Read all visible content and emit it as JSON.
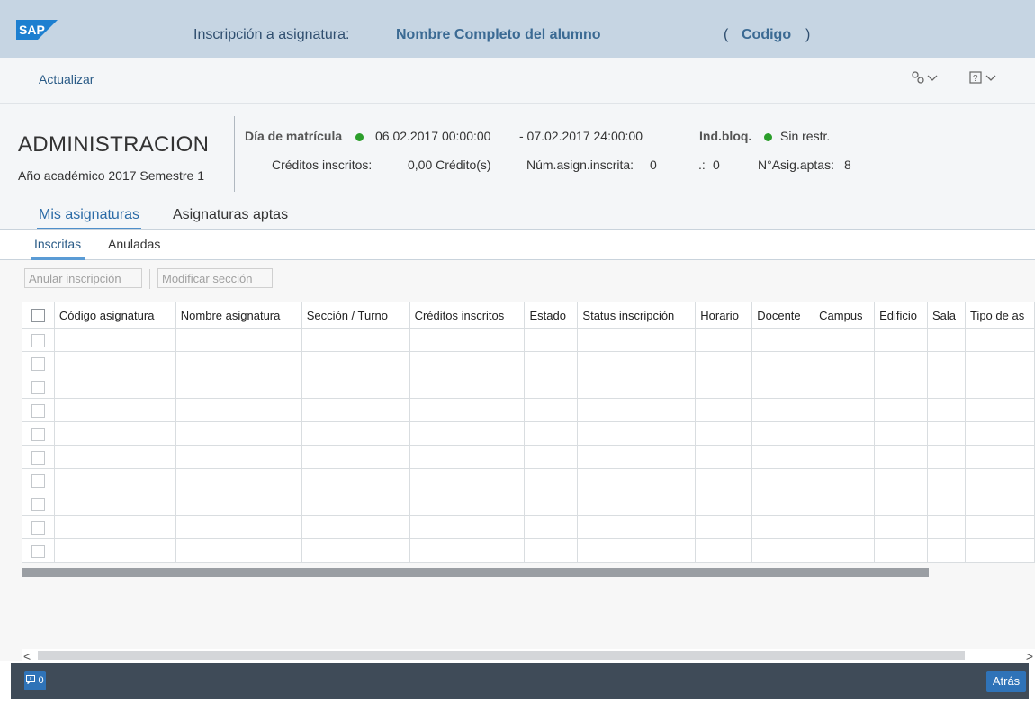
{
  "shell": {
    "logo_text": "SAP",
    "title_label": "Inscripción a asignatura:",
    "student_name": "Nombre Completo del alumno",
    "paren_open": "(",
    "code": "Codigo",
    "paren_close": ")"
  },
  "toolbar": {
    "refresh_label": "Actualizar",
    "settings_icon": "gear-icon",
    "help_icon": "help-icon"
  },
  "header": {
    "title": "ADMINISTRACION",
    "subtitle": "Año académico 2017 Semestre 1",
    "enrollment_day_label": "Día de matrícula",
    "enrollment_start": "06.02.2017 00:00:00",
    "enrollment_end": "- 07.02.2017 24:00:00",
    "block_label": "Ind.bloq.",
    "block_value": "Sin restr.",
    "credits_label": "Créditos inscritos:",
    "credits_value": "0,00 Crédito(s)",
    "enrolled_count_label": "Núm.asign.inscrita:",
    "enrolled_count_value": "0",
    "misc_label": ".:",
    "misc_value": "0",
    "eligible_label": "N°Asig.aptas:",
    "eligible_value": "8",
    "status_color": "#2b9e2b"
  },
  "tabs": {
    "primary": [
      "Mis asignaturas",
      "Asignaturas aptas"
    ],
    "secondary": [
      "Inscritas",
      "Anuladas"
    ]
  },
  "actions": {
    "cancel_label": "Anular inscripción",
    "modify_label": "Modificar sección"
  },
  "table": {
    "columns": [
      "Código asignatura",
      "Nombre asignatura",
      "Sección / Turno",
      "Créditos inscritos",
      "Estado",
      "Status inscripción",
      "Horario",
      "Docente",
      "Campus",
      "Edificio",
      "Sala",
      "Tipo de as"
    ],
    "empty_rows": 10
  },
  "scroll": {
    "left_arrow": "<",
    "right_arrow": ">"
  },
  "footer": {
    "messages_count": "0",
    "back_label": "Atrás",
    "accent_color": "#2f73b8"
  }
}
